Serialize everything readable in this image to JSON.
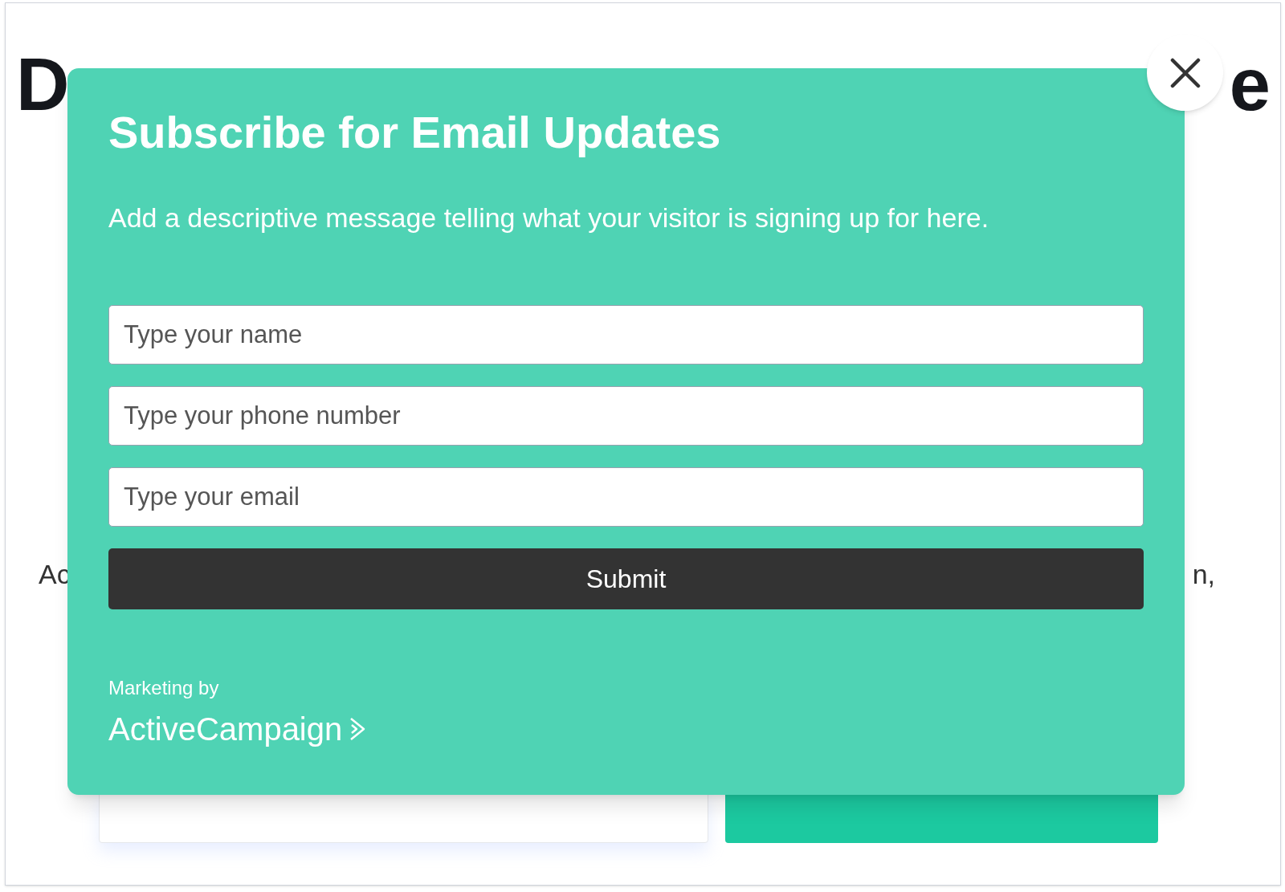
{
  "background_page": {
    "heading_fragments": [
      "D",
      "e"
    ],
    "paragraph_fragments": [
      "Ac",
      "n,"
    ]
  },
  "modal": {
    "title": "Subscribe for Email Updates",
    "description": "Add a descriptive message telling what your visitor is signing up for here.",
    "fields": [
      {
        "placeholder": "Type your name"
      },
      {
        "placeholder": "Type your phone number"
      },
      {
        "placeholder": "Type your email"
      }
    ],
    "submit_label": "Submit",
    "footer": {
      "caption": "Marketing by",
      "brand": "ActiveCampaign"
    }
  }
}
